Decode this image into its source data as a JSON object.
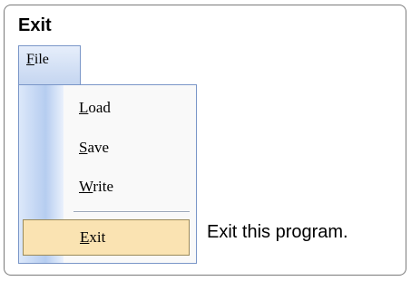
{
  "title": "Exit",
  "menubar": {
    "file": {
      "accel": "F",
      "rest": "ile"
    }
  },
  "menu": {
    "items": [
      {
        "accel": "L",
        "rest": "oad"
      },
      {
        "accel": "S",
        "rest": "ave"
      },
      {
        "accel": "W",
        "rest": "rite"
      }
    ],
    "exit": {
      "accel": "E",
      "rest": "xit"
    }
  },
  "description": "Exit this program."
}
